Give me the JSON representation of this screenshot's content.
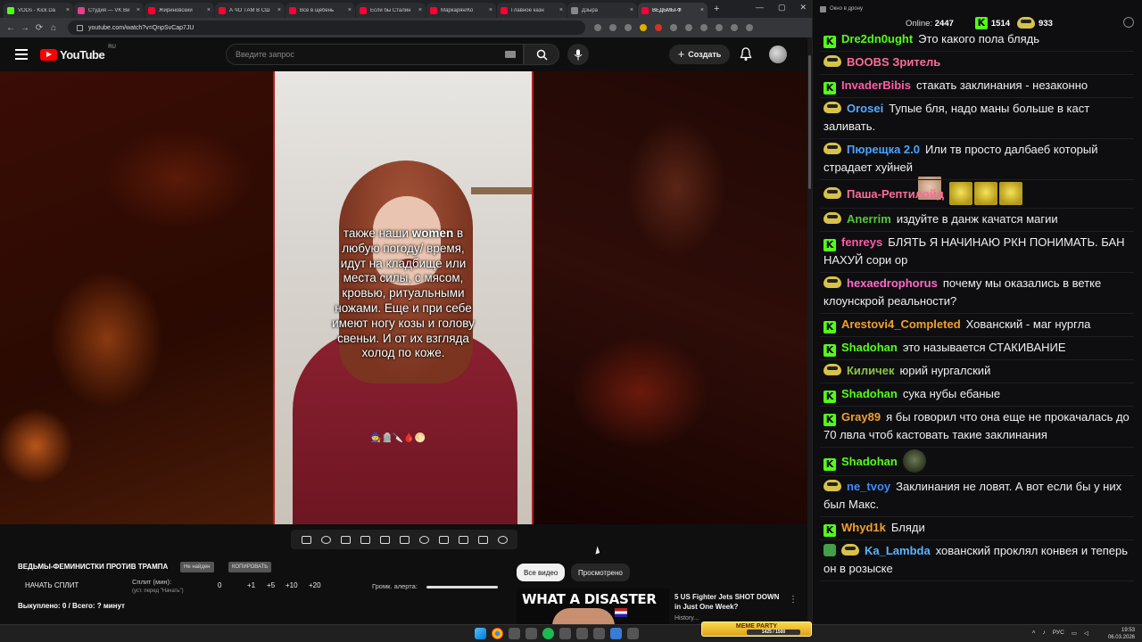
{
  "browser": {
    "tabs": [
      {
        "label": "VODs - Kick Da",
        "icon": "kick"
      },
      {
        "label": "Студия — VK Ви",
        "icon": "vk"
      },
      {
        "label": "Жириновский",
        "icon": "youtube"
      },
      {
        "label": "А ЧО ТАМ В СШ",
        "icon": "youtube"
      },
      {
        "label": "Все в щебень",
        "icon": "youtube"
      },
      {
        "label": "Если бы Сталин",
        "icon": "youtube"
      },
      {
        "label": "Маркарян/Ко",
        "icon": "youtube"
      },
      {
        "label": "Главное казн",
        "icon": "youtube"
      },
      {
        "label": "Дзыра",
        "icon": "gray"
      },
      {
        "label": "ВЕДЬМЫ-Ф",
        "icon": "youtube",
        "active": true
      }
    ],
    "url": "youtube.com/watch?v=QnpSvCap7JU"
  },
  "youtube": {
    "logo_text": "YouTube",
    "logo_region": "RU",
    "search_placeholder": "Введите запрос",
    "create_label": "Создать"
  },
  "video": {
    "caption_lines": [
      {
        "pre": "также наши ",
        "bold": "women",
        "post": " в"
      },
      {
        "pre": "любую погоду/ время,",
        "bold": "",
        "post": ""
      },
      {
        "pre": "идут на кладбище или",
        "bold": "",
        "post": ""
      },
      {
        "pre": "места силы, с мясом,",
        "bold": "",
        "post": ""
      },
      {
        "pre": "кровью, ритуальными",
        "bold": "",
        "post": ""
      },
      {
        "pre": "ножами. Еще и при себе",
        "bold": "",
        "post": ""
      },
      {
        "pre": "имеют ногу козы и голову",
        "bold": "",
        "post": ""
      },
      {
        "pre": "свеньи. И от их взгляда",
        "bold": "",
        "post": ""
      },
      {
        "pre": "холод по коже.",
        "bold": "",
        "post": ""
      }
    ]
  },
  "below": {
    "title": "ВЕДЬМЫ-ФЕМИНИСТКИ ПРОТИВ ТРАМПА",
    "pill1": "Не найден",
    "pill2": "КОПИРОВАТЬ",
    "split_start": "НАЧАТЬ СПЛИТ",
    "split_label": "Сплит (мин):",
    "split_hint": "(уст. перед \"Начать\")",
    "split_value": "0",
    "steps": [
      "+1",
      "+5",
      "+10",
      "+20"
    ],
    "volume_label": "Громк. алерта:",
    "volume_level": 1.0,
    "bought": "Выкуплено: 0 / Всего: ? минут",
    "chip_all": "Все видео",
    "chip_watched": "Просмотрено",
    "rec_thumb_text": "WHAT A DISASTER",
    "rec_title": "5 US Fighter Jets SHOT DOWN in Just One Week?",
    "rec_meta": "History..."
  },
  "chat": {
    "window_title": "Окно в дрону",
    "online_label": "Online:",
    "online_count": "2447",
    "kick_count": "1514",
    "coin_count": "933",
    "messages": [
      {
        "badge": "kick",
        "name": "Dre2dn0ught",
        "color": "#53fc18",
        "text": "Это какого пола блядь",
        "emotes": []
      },
      {
        "badge": "pepe",
        "name": "BOOBS Зритель",
        "color": "#ff6b9a",
        "text": "",
        "emotes": [
          "face",
          "face",
          "face",
          "face"
        ]
      },
      {
        "badge": "kick",
        "name": "InvaderBibis",
        "color": "#ff5ca8",
        "text": "стакать заклинания - незаконно",
        "emotes": []
      },
      {
        "badge": "pepe",
        "name": "Orosei",
        "color": "#5aa9ff",
        "text": "Тупые бля, надо маны больше в каст заливать.",
        "emotes": []
      },
      {
        "badge": "pepe",
        "name": "Пюрещка 2.0",
        "color": "#4aa3ff",
        "text": "Или тв просто далбаеб который страдает хуйней",
        "emotes": []
      },
      {
        "badge": "pepe",
        "name": "Паша-Рептилойд",
        "color": "#ff6b9a",
        "text": "",
        "emotes": [
          "cash",
          "cash",
          "cash"
        ]
      },
      {
        "badge": "pepe",
        "name": "Anerrim",
        "color": "#53c83a",
        "text": "издуйте в данж качатся магии",
        "emotes": []
      },
      {
        "badge": "kick",
        "name": "fenreys",
        "color": "#ff5ca8",
        "text": "БЛЯТЬ Я НАЧИНАЮ РКН ПОНИМАТЬ. БАН НАХУЙ сори ор",
        "emotes": []
      },
      {
        "badge": "pepe",
        "name": "hexaedrophorus",
        "color": "#ff6bc9",
        "text": "почему мы оказались в ветке клоунскрой реальности?",
        "emotes": []
      },
      {
        "badge": "kick",
        "name": "Arestovi4_Completed",
        "color": "#f0a030",
        "text": "Хованский - маг нургла",
        "emotes": []
      },
      {
        "badge": "kick",
        "name": "Shadohan",
        "color": "#53fc18",
        "text": "это называется СТАКИВАНИЕ",
        "emotes": []
      },
      {
        "badge": "pepe",
        "name": "Киличек",
        "color": "#8bc34a",
        "text": "юрий нургалский",
        "emotes": []
      },
      {
        "badge": "kick",
        "name": "Shadohan",
        "color": "#53fc18",
        "text": "сука нубы ебаные",
        "emotes": []
      },
      {
        "badge": "kick",
        "name": "Gray89",
        "color": "#f0a030",
        "text": "я бы говорил что она еще не прокачалась до 70 лвла чтоб кастовать такие заклинания",
        "emotes": []
      },
      {
        "badge": "kick",
        "name": "Shadohan",
        "color": "#53fc18",
        "text": "",
        "emotes": [
          "frog"
        ]
      },
      {
        "badge": "pepe",
        "name": "ne_tvoy",
        "color": "#3d8bff",
        "text": "Заклинания не ловят. А вот если бы у них был Макс.",
        "emotes": []
      },
      {
        "badge": "kick",
        "name": "Whyd1k",
        "color": "#f0a030",
        "text": "Бляди",
        "emotes": []
      },
      {
        "badge": "shield",
        "name": "Ka_Lambda",
        "color": "#5ab4ff",
        "text": "хованский проклял конвея и теперь он в розыске",
        "emotes": []
      }
    ]
  },
  "taskbar": {
    "meme_label": "MEME PARTY",
    "meme_progress": "1425 / 1500",
    "lang": "РУС",
    "time": "19:53",
    "date": "06.03.2026"
  }
}
